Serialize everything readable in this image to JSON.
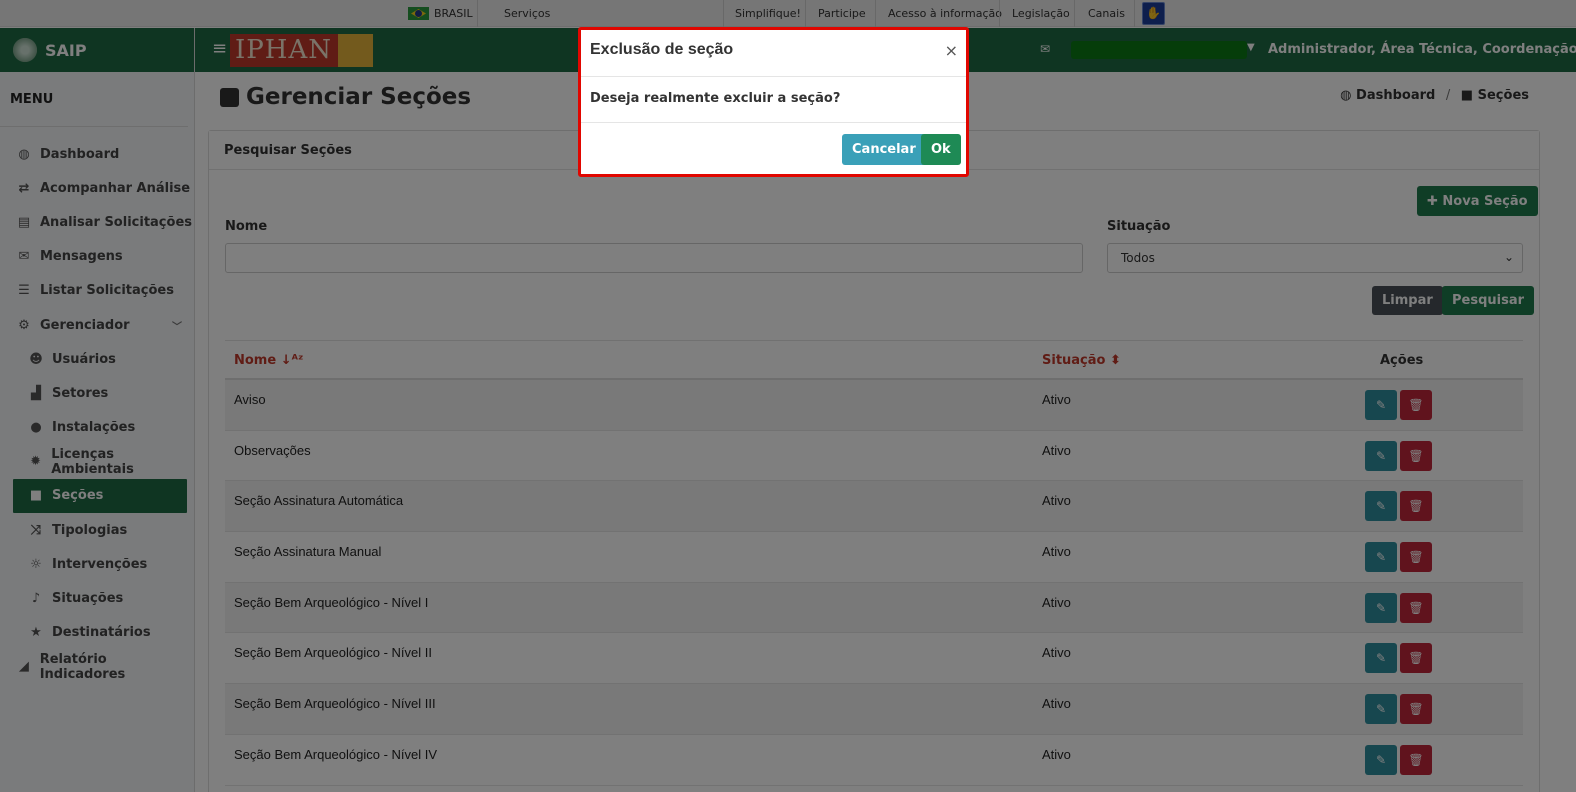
{
  "govbar": {
    "country": "BRASIL",
    "services": "Serviços",
    "links": [
      "Simplifique!",
      "Participe",
      "Acesso à informação",
      "Legislação",
      "Canais"
    ]
  },
  "brand": {
    "name": "SAIP"
  },
  "topbar": {
    "logo_text": "IPHAN",
    "user_role": "Administrador, Área Técnica, Coordenação..."
  },
  "sidebar": {
    "title": "MENU",
    "items": [
      {
        "label": "Dashboard",
        "icon": "dashboard-icon",
        "glyph": "◍"
      },
      {
        "label": "Acompanhar Análise",
        "icon": "exchange-icon",
        "glyph": "⇄"
      },
      {
        "label": "Analisar Solicitações",
        "icon": "book-icon",
        "glyph": "▤"
      },
      {
        "label": "Mensagens",
        "icon": "comments-icon",
        "glyph": "✉"
      },
      {
        "label": "Listar Solicitações",
        "icon": "list-icon",
        "glyph": "☰"
      },
      {
        "label": "Gerenciador",
        "icon": "cogs-icon",
        "glyph": "⚙"
      },
      {
        "label": "Usuários",
        "icon": "users-icon",
        "glyph": "☻"
      },
      {
        "label": "Setores",
        "icon": "industry-icon",
        "glyph": "▟"
      },
      {
        "label": "Instalações",
        "icon": "circle-icon",
        "glyph": "●"
      },
      {
        "label": "Licenças Ambientais",
        "icon": "certificate-icon",
        "glyph": "✹"
      },
      {
        "label": "Seções",
        "icon": "square-icon",
        "glyph": "■"
      },
      {
        "label": "Tipologias",
        "icon": "random-icon",
        "glyph": "⤨"
      },
      {
        "label": "Intervenções",
        "icon": "sun-icon",
        "glyph": "☼"
      },
      {
        "label": "Situações",
        "icon": "bell-icon",
        "glyph": "♪"
      },
      {
        "label": "Destinatários",
        "icon": "star-icon",
        "glyph": "★"
      },
      {
        "label": "Relatório Indicadores",
        "icon": "area-chart-icon",
        "glyph": "◢"
      }
    ]
  },
  "page": {
    "title": "Gerenciar Seções",
    "breadcrumb": [
      "Dashboard",
      "Seções"
    ]
  },
  "search": {
    "header": "Pesquisar Seções",
    "new_button": "Nova Seção",
    "name_label": "Nome",
    "name_value": "",
    "status_label": "Situação",
    "status_value": "Todos",
    "clear_button": "Limpar",
    "search_button": "Pesquisar"
  },
  "table": {
    "headers": [
      "Nome",
      "Situação",
      "Ações"
    ],
    "rows": [
      {
        "name": "Aviso",
        "status": "Ativo"
      },
      {
        "name": "Observações",
        "status": "Ativo"
      },
      {
        "name": "Seção Assinatura Automática",
        "status": "Ativo"
      },
      {
        "name": "Seção Assinatura Manual",
        "status": "Ativo"
      },
      {
        "name": "Seção Bem Arqueológico - Nível I",
        "status": "Ativo"
      },
      {
        "name": "Seção Bem Arqueológico - Nível II",
        "status": "Ativo"
      },
      {
        "name": "Seção Bem Arqueológico - Nível III",
        "status": "Ativo"
      },
      {
        "name": "Seção Bem Arqueológico - Nível IV",
        "status": "Ativo"
      }
    ]
  },
  "modal": {
    "title": "Exclusão de seção",
    "message": "Deseja realmente excluir a seção?",
    "cancel": "Cancelar",
    "ok": "Ok"
  },
  "colors": {
    "brand_green": "#1e6a44",
    "danger": "#c0263a",
    "info": "#2e8f9e",
    "highlight": "#e10600"
  }
}
